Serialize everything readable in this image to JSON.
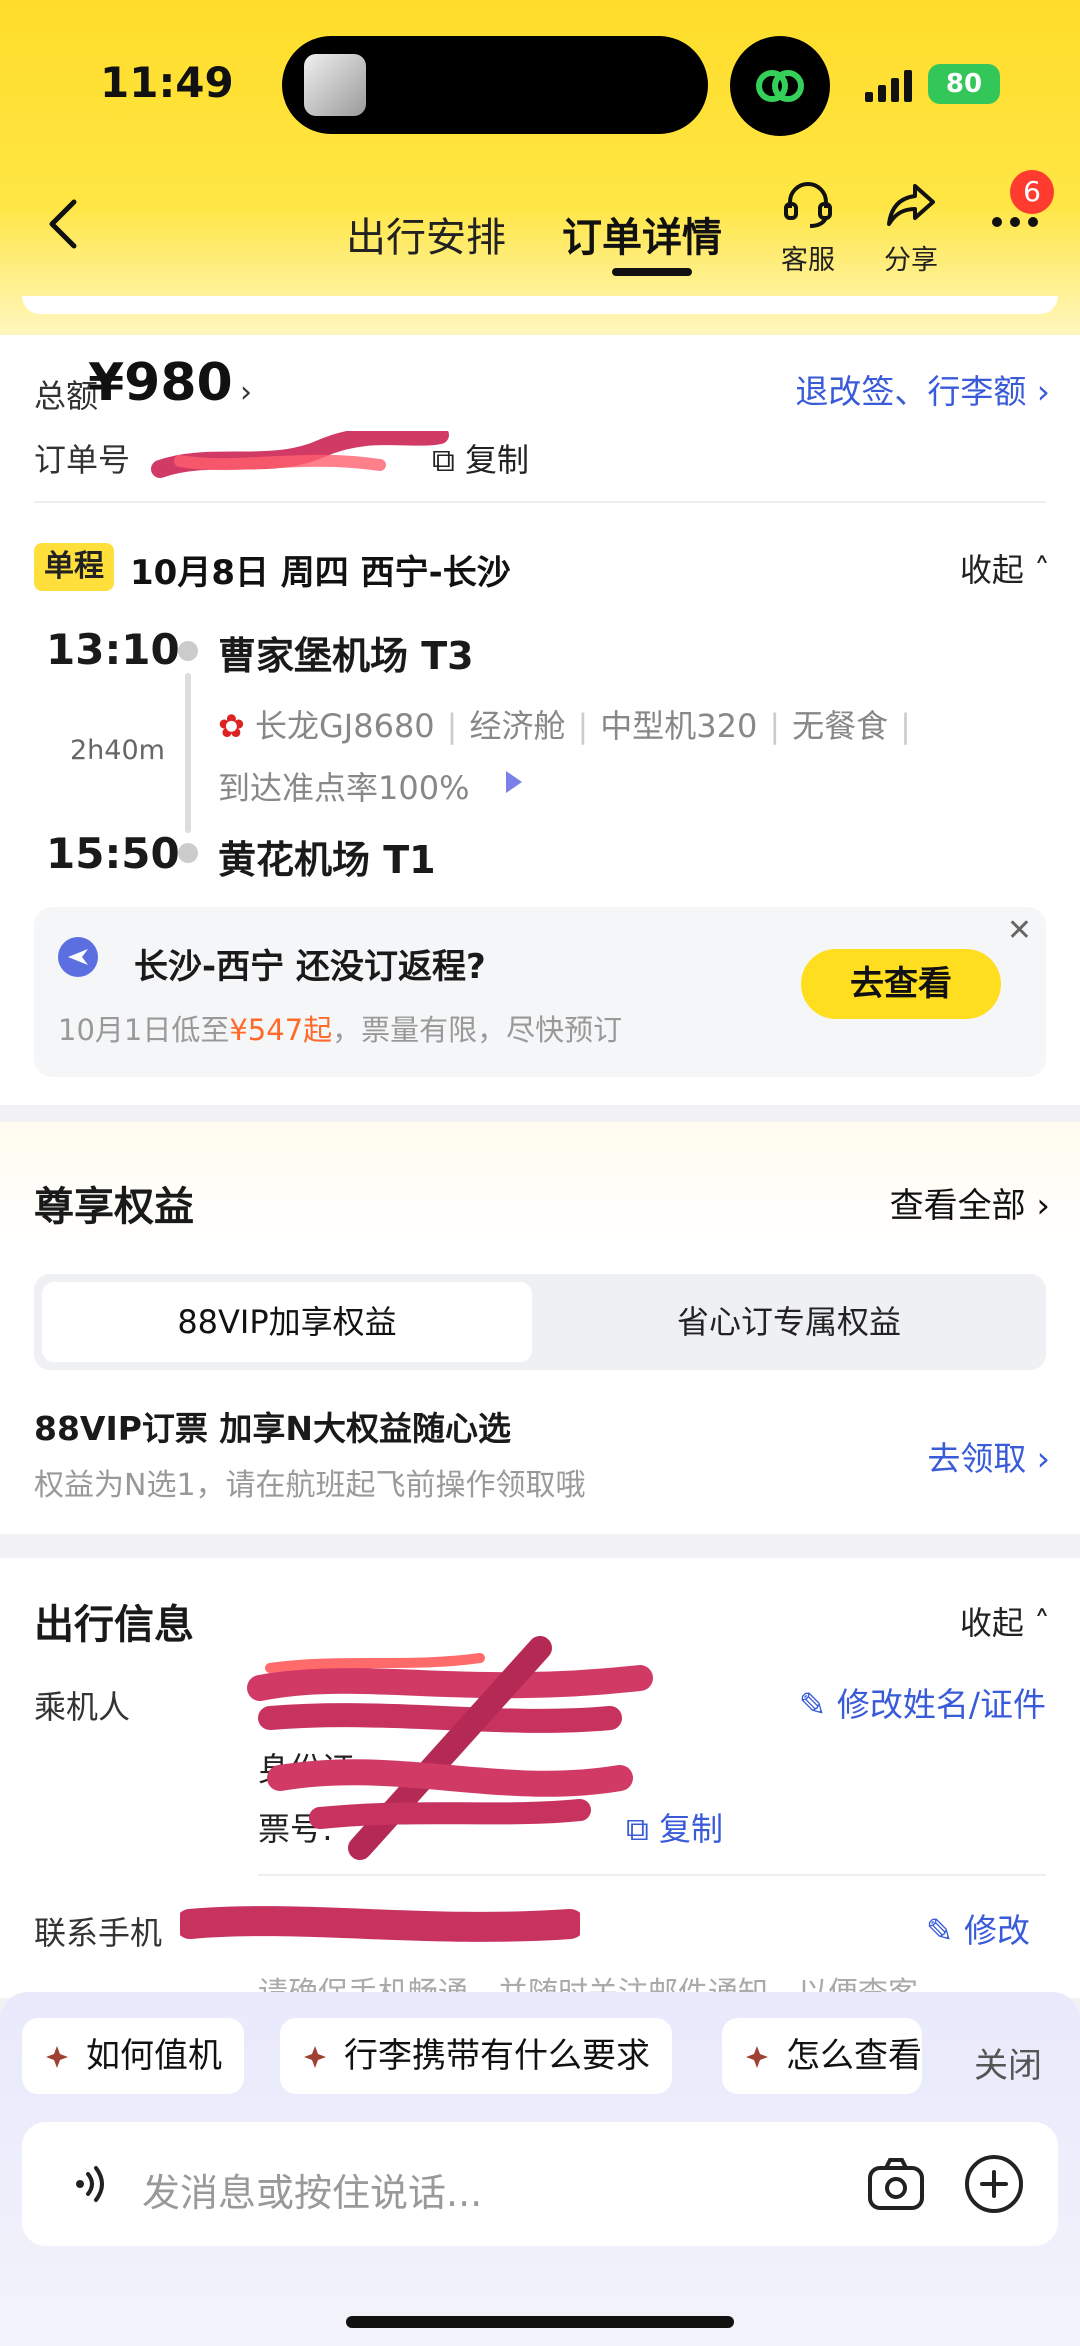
{
  "status_bar": {
    "time": "11:49",
    "battery": "80"
  },
  "header": {
    "tabs": [
      {
        "label": "出行安排"
      },
      {
        "label": "订单详情"
      }
    ],
    "customer_service": "客服",
    "share": "分享",
    "more_badge": "6"
  },
  "order": {
    "total_label": "总额",
    "total_value": "¥980",
    "refund_link": "退改签、行李额",
    "order_no_label": "订单号",
    "copy": "复制"
  },
  "flight": {
    "tag": "单程",
    "summary": "10月8日  周四  西宁-长沙",
    "collapse": "收起",
    "dep_time": "13:10",
    "dep_airport": "曹家堡机场 T3",
    "duration": "2h40m",
    "airline": "长龙GJ8680",
    "cabin": "经济舱",
    "aircraft": "中型机320",
    "meal": "无餐食",
    "ontime": "到达准点率100%",
    "arr_time": "15:50",
    "arr_airport": "黄花机场 T1"
  },
  "return_promo": {
    "title": "长沙-西宁 还没订返程?",
    "sub_prefix": "10月1日低至",
    "price": "¥547起",
    "sub_suffix": "，票量有限，尽快预订",
    "button": "去查看"
  },
  "benefits": {
    "title": "尊享权益",
    "view_all": "查看全部",
    "tabs": [
      {
        "label": "88VIP加享权益"
      },
      {
        "label": "省心订专属权益"
      }
    ],
    "vip_title": "88VIP订票 加享N大权益随心选",
    "vip_sub": "权益为N选1，请在航班起飞前操作领取哦",
    "claim": "去领取"
  },
  "travel_info": {
    "title": "出行信息",
    "collapse": "收起",
    "passenger_label": "乘机人",
    "edit_name": "修改姓名/证件",
    "id_label": "身份证:",
    "ticket_label": "票号:",
    "copy": "复制",
    "contact_label": "联系手机",
    "edit_contact": "修改",
    "notice": "请确保手机畅通，并随时关注邮件通知，以便查客"
  },
  "assistant": {
    "chips": [
      {
        "label": "如何值机"
      },
      {
        "label": "行李携带有什么要求"
      },
      {
        "label": "怎么查看"
      }
    ],
    "close": "关闭",
    "placeholder": "发消息或按住说话..."
  },
  "colors": {
    "brand_yellow": "#ffde1f",
    "link_blue": "#3a5bd9",
    "price_orange": "#ff6a2b"
  }
}
